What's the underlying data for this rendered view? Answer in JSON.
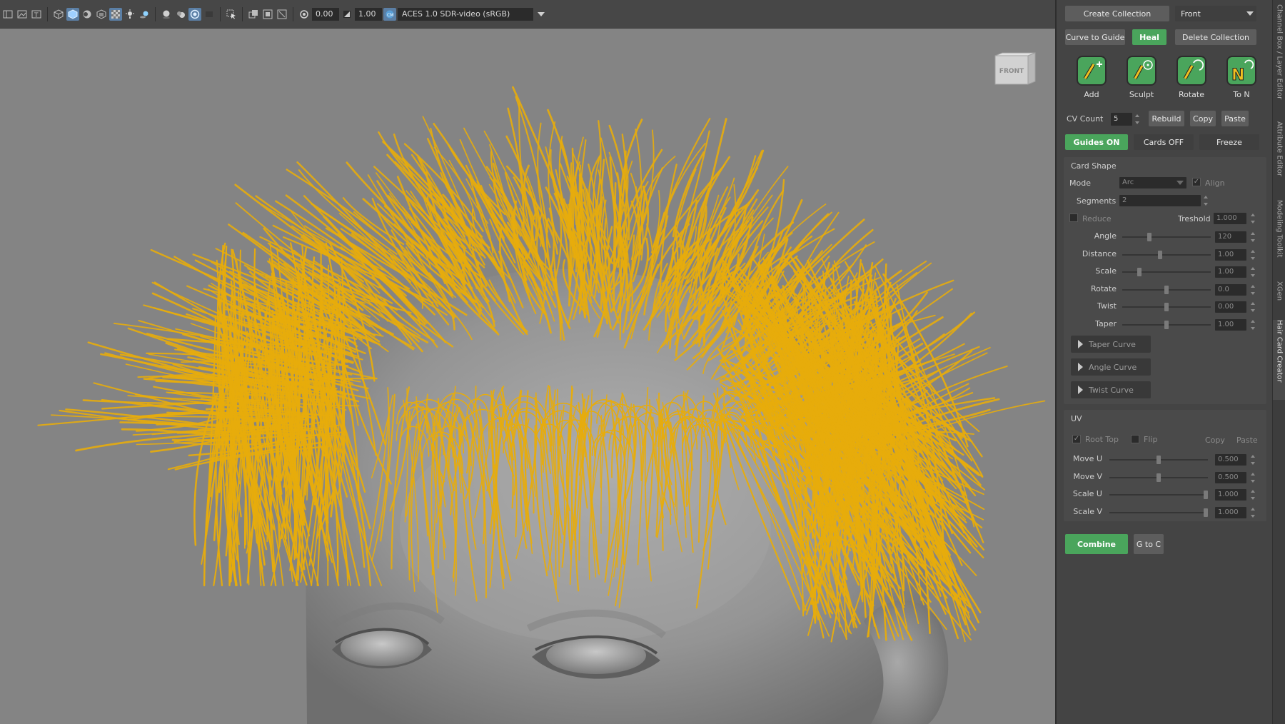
{
  "toolbar": {
    "exposure_value": "0.00",
    "gamma_value": "1.00",
    "color_space": "ACES 1.0 SDR-video (sRGB)"
  },
  "viewport": {
    "view_cube_label": "FRONT",
    "hair_color": "#e7ac0c",
    "head_color": "#8f8f8f",
    "background_color": "#848484"
  },
  "panel": {
    "create_collection": "Create Collection",
    "camera_select": "Front",
    "curve_to_guide": "Curve to Guide",
    "heal": "Heal",
    "delete_collection": "Delete Collection",
    "tools": [
      {
        "label": "Add",
        "icon": "add-curve-icon"
      },
      {
        "label": "Sculpt",
        "icon": "sculpt-icon"
      },
      {
        "label": "Rotate",
        "icon": "rotate-icon"
      },
      {
        "label": "To N",
        "icon": "to-n-icon"
      }
    ],
    "cv_count_label": "CV Count",
    "cv_count_value": "5",
    "rebuild": "Rebuild",
    "copy": "Copy",
    "paste": "Paste",
    "guides_on": "Guides ON",
    "cards_off": "Cards OFF",
    "freeze": "Freeze",
    "card_shape": {
      "title": "Card Shape",
      "mode_label": "Mode",
      "mode_value": "Arc",
      "align_label": "Align",
      "align_checked": true,
      "segments_label": "Segments",
      "segments_value": "2",
      "reduce_label": "Reduce",
      "reduce_checked": false,
      "treshold_label": "Treshold",
      "treshold_value": "1.000",
      "sliders": [
        {
          "label": "Angle",
          "value": "120",
          "position": 0.3
        },
        {
          "label": "Distance",
          "value": "1.00",
          "position": 0.42
        },
        {
          "label": "Scale",
          "value": "1.00",
          "position": 0.18
        },
        {
          "label": "Rotate",
          "value": "0.0",
          "position": 0.5
        },
        {
          "label": "Twist",
          "value": "0.00",
          "position": 0.5
        },
        {
          "label": "Taper",
          "value": "1.00",
          "position": 0.5
        }
      ],
      "taper_curve": "Taper Curve",
      "angle_curve": "Angle Curve",
      "twist_curve": "Twist Curve"
    },
    "uv": {
      "title": "UV",
      "root_top_label": "Root Top",
      "root_top_checked": true,
      "flip_label": "Flip",
      "flip_checked": false,
      "copy": "Copy",
      "paste": "Paste",
      "sliders": [
        {
          "label": "Move U",
          "value": "0.500",
          "position": 0.5
        },
        {
          "label": "Move V",
          "value": "0.500",
          "position": 0.5
        },
        {
          "label": "Scale U",
          "value": "1.000",
          "position": 1.0
        },
        {
          "label": "Scale V",
          "value": "1.000",
          "position": 1.0
        }
      ]
    },
    "combine": "Combine",
    "g_to_c": "G to C"
  },
  "side_tabs": [
    "Channel Box / Layer Editor",
    "Attribute Editor",
    "Modeling Toolkit",
    "XGen",
    "Hair Card Creator"
  ]
}
